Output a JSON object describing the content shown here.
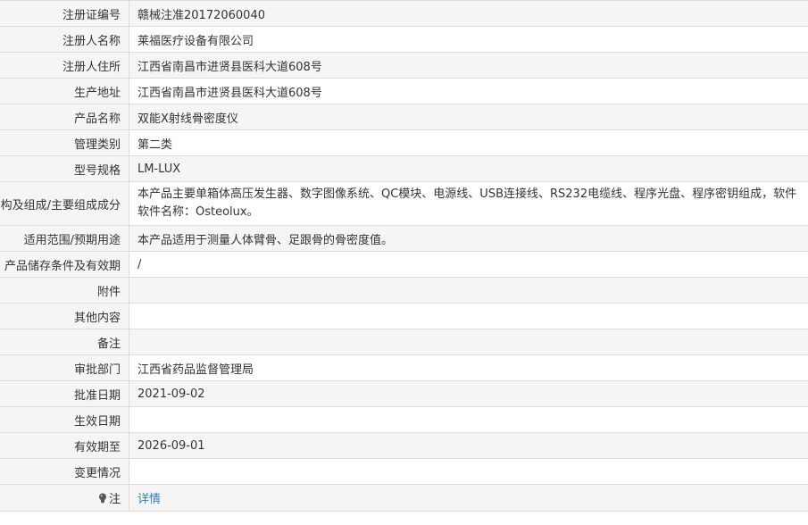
{
  "rows": [
    {
      "label": "注册证编号",
      "value": "赣械注准20172060040"
    },
    {
      "label": "注册人名称",
      "value": "莱福医疗设备有限公司"
    },
    {
      "label": "注册人住所",
      "value": "江西省南昌市进贤县医科大道608号"
    },
    {
      "label": "生产地址",
      "value": "江西省南昌市进贤县医科大道608号"
    },
    {
      "label": "产品名称",
      "value": "双能X射线骨密度仪"
    },
    {
      "label": "管理类别",
      "value": "第二类"
    },
    {
      "label": "型号规格",
      "value": "LM-LUX"
    },
    {
      "label": "结构及组成/主要组成成分",
      "value": "本产品主要单箱体高压发生器、数字图像系统、QC模块、电源线、USB连接线、RS232电缆线、程序光盘、程序密钥组成，软件软件名称：Osteolux。"
    },
    {
      "label": "适用范围/预期用途",
      "value": "本产品适用于测量人体臂骨、足跟骨的骨密度值。"
    },
    {
      "label": "产品储存条件及有效期",
      "value": "/"
    },
    {
      "label": "附件",
      "value": ""
    },
    {
      "label": "其他内容",
      "value": ""
    },
    {
      "label": "备注",
      "value": ""
    },
    {
      "label": "审批部门",
      "value": "江西省药品监督管理局"
    },
    {
      "label": "批准日期",
      "value": "2021-09-02"
    },
    {
      "label": "生效日期",
      "value": ""
    },
    {
      "label": "有效期至",
      "value": "2026-09-01"
    },
    {
      "label": "变更情况",
      "value": ""
    }
  ],
  "note": {
    "label": "注",
    "icon": "lightbulb-icon",
    "link_text": "详情",
    "link_color": "#2f7bbf"
  }
}
